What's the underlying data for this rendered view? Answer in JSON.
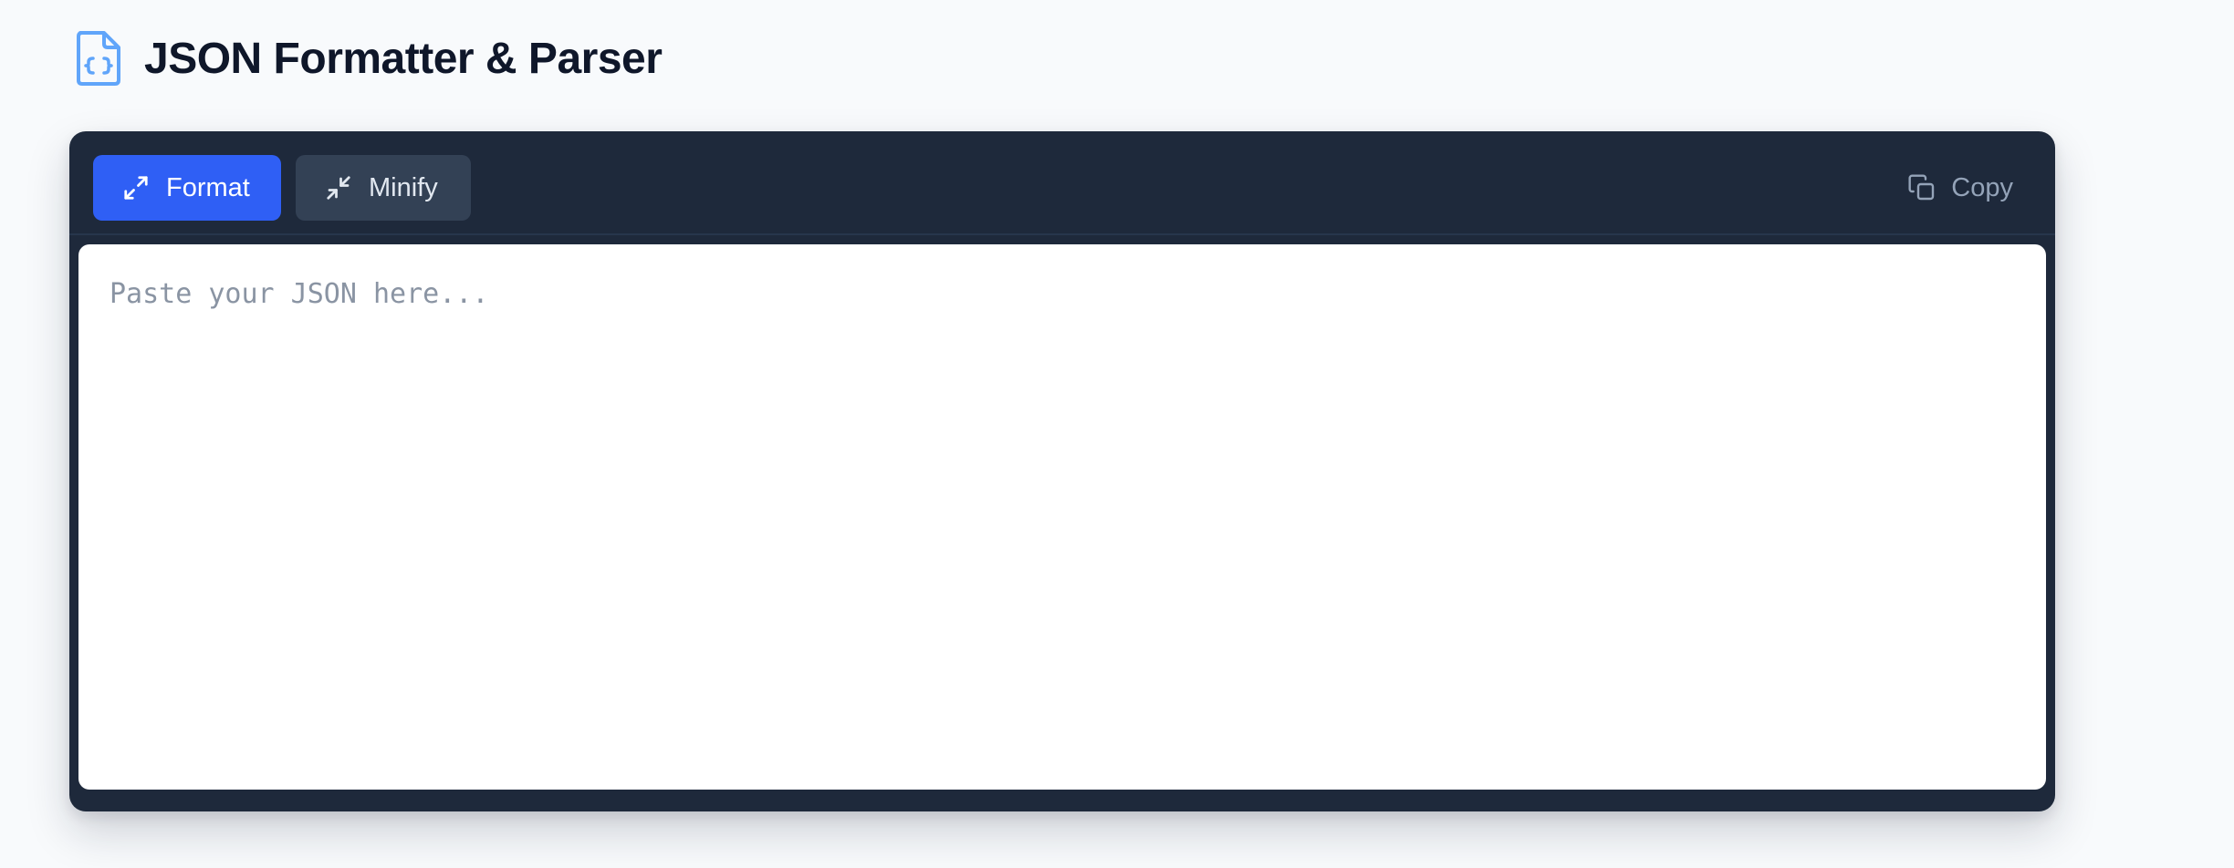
{
  "header": {
    "title": "JSON Formatter & Parser",
    "icon": "file-json-icon"
  },
  "toolbar": {
    "format_label": "Format",
    "format_icon": "expand-icon",
    "minify_label": "Minify",
    "minify_icon": "collapse-icon",
    "copy_label": "Copy",
    "copy_icon": "copy-icon"
  },
  "editor": {
    "value": "",
    "placeholder": "Paste your JSON here..."
  },
  "colors": {
    "page_background": "#f8fafc",
    "panel_background": "#1e293b",
    "primary_button": "#2f5ff5",
    "secondary_button": "#334155",
    "icon_accent": "#60a5fa",
    "title_text": "#0f172a"
  }
}
